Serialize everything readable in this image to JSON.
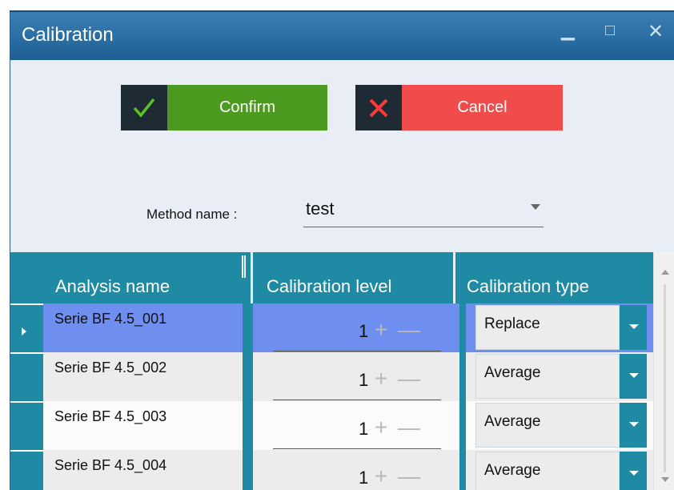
{
  "window": {
    "title": "Calibration",
    "controls": {
      "minimize": "▁",
      "maximize": "□",
      "close": "✕"
    }
  },
  "actions": {
    "confirm_label": "Confirm",
    "cancel_label": "Cancel",
    "confirm_icon": "check-icon",
    "cancel_icon": "x-icon"
  },
  "method": {
    "label": "Method name :",
    "value": "test"
  },
  "grid": {
    "columns": [
      "Analysis name",
      "Calibration level",
      "Calibration type"
    ],
    "rows": [
      {
        "name": "Serie BF 4.5_001",
        "level": "1",
        "type": "Replace",
        "selected": true
      },
      {
        "name": "Serie BF 4.5_002",
        "level": "1",
        "type": "Average",
        "selected": false
      },
      {
        "name": "Serie BF 4.5_003",
        "level": "1",
        "type": "Average",
        "selected": false
      },
      {
        "name": "Serie BF 4.5_004",
        "level": "1",
        "type": "Average",
        "selected": false
      }
    ]
  },
  "colors": {
    "titlebar": "#2a6fa6",
    "confirm": "#4c9a1f",
    "cancel": "#f04c4c",
    "grid_header": "#1e8aa3",
    "selected_row": "#6e8ff0"
  }
}
